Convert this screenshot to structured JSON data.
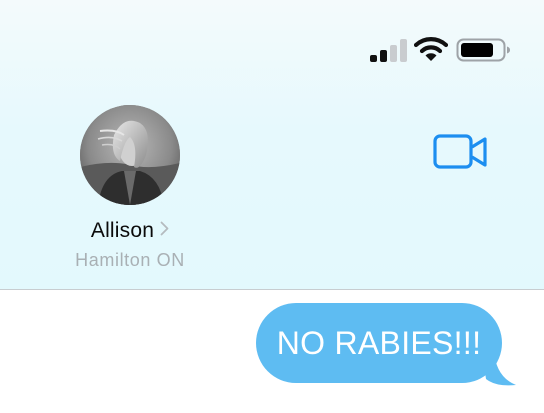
{
  "status_bar": {
    "signal_icon": "cellular-signal-icon",
    "signal_strength_bars": 2,
    "signal_total_bars": 4,
    "wifi_icon": "wifi-icon",
    "battery_icon": "battery-icon",
    "battery_level": 0.8
  },
  "contact": {
    "name": "Allison",
    "chevron": "›",
    "location": "Hamilton ON",
    "avatar_icon": "contact-photo"
  },
  "header_actions": {
    "video_call_icon": "video-camera-icon"
  },
  "messages": [
    {
      "direction": "outgoing",
      "text": "NO RABIES!!!"
    }
  ],
  "colors": {
    "accent": "#1c8ef0",
    "bubble": "#5ebcf2",
    "header_bg": "#e4f9fd",
    "secondary_text": "#a9b0b4"
  }
}
